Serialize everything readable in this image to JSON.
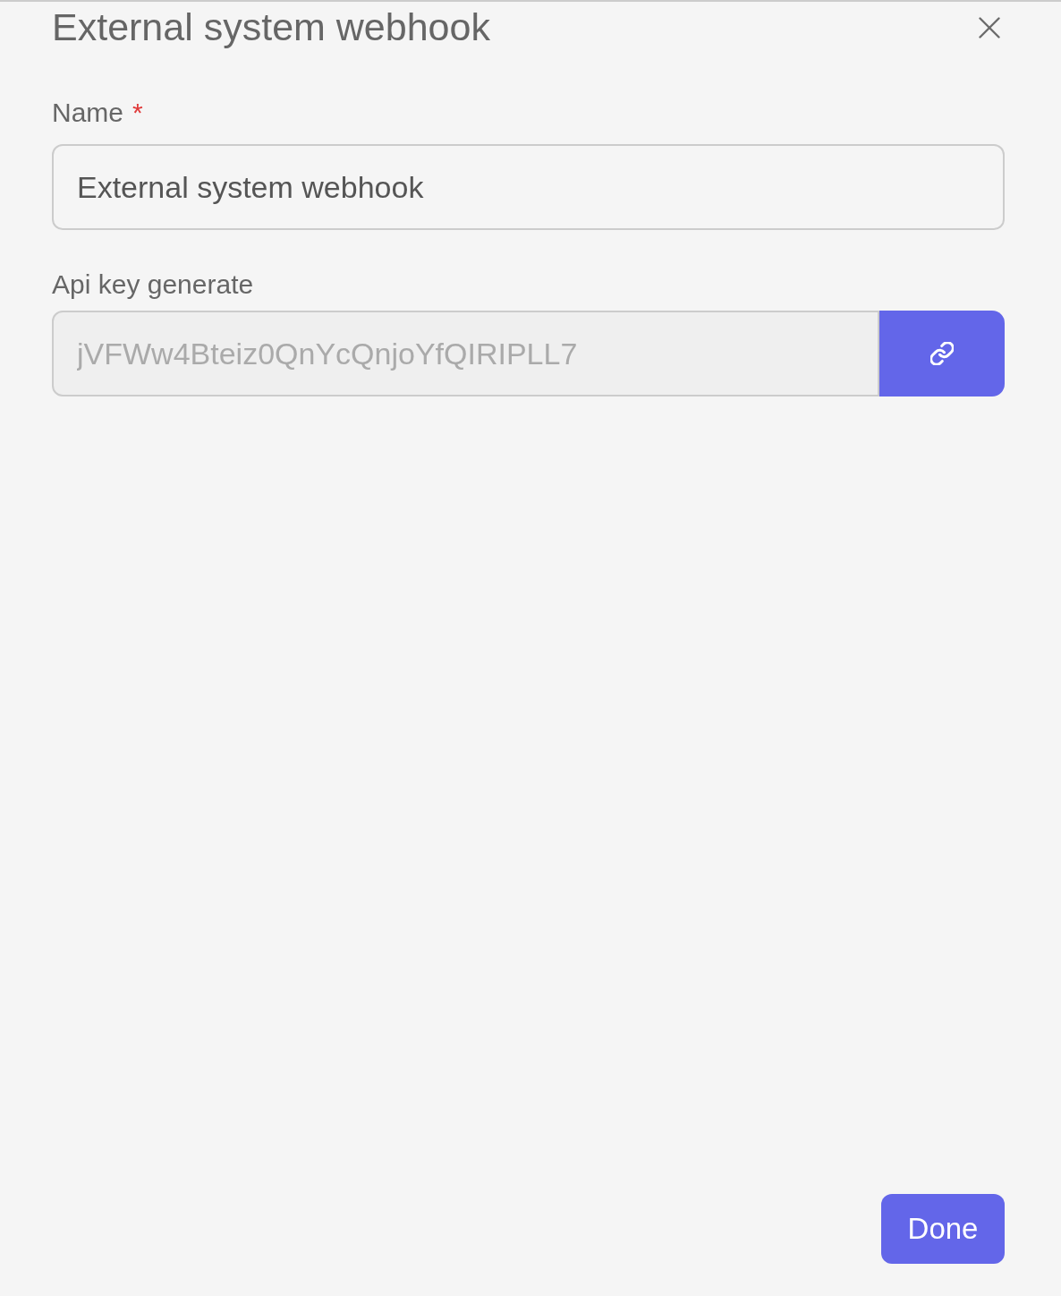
{
  "dialog": {
    "title": "External system webhook"
  },
  "fields": [
    {
      "kind": "text",
      "label": "Name",
      "required_mark": "*",
      "value": "External system webhook",
      "disabled": false
    },
    {
      "kind": "generated",
      "label": "Api key generate",
      "value": "jVFWw4Bteiz0QnYcQnjoYfQIRIPLL7",
      "disabled": true
    }
  ],
  "done_button": {
    "label": "Done"
  }
}
